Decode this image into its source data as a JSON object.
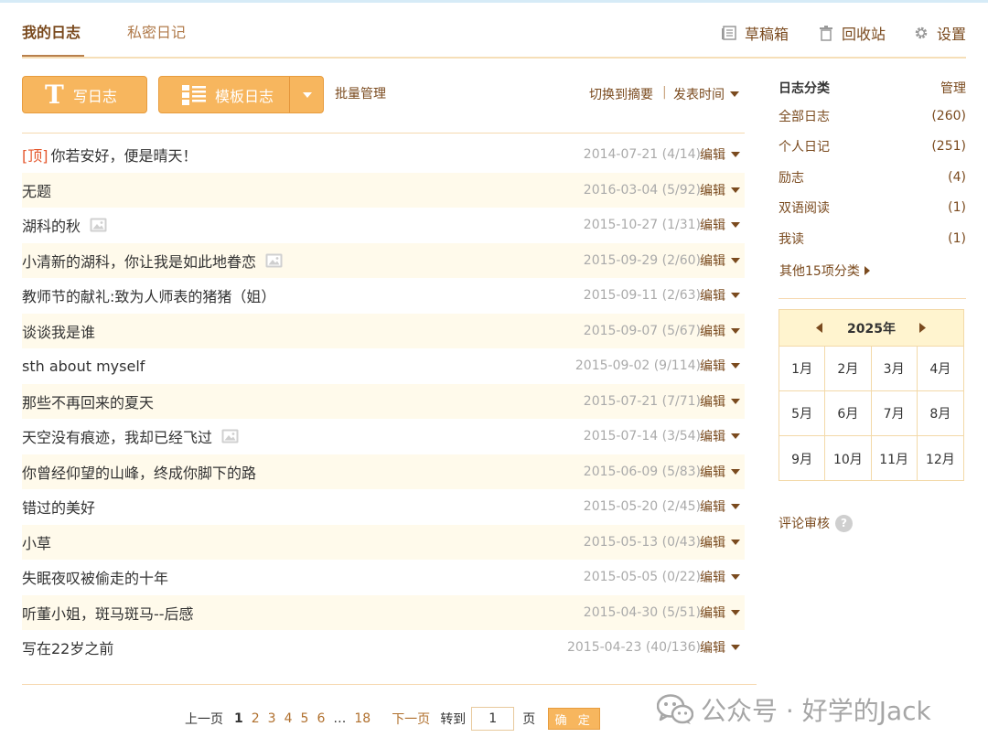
{
  "tabs": {
    "my_diary": "我的日志",
    "private_diary": "私密日记"
  },
  "tools": {
    "drafts": "草稿箱",
    "trash": "回收站",
    "settings": "设置"
  },
  "actions": {
    "write": "写日志",
    "template": "模板日志",
    "batch": "批量管理",
    "toggle_summary": "切换到摘要",
    "separator": "|",
    "sort": "发表时间"
  },
  "diary_list": [
    {
      "pin": "[顶]",
      "title": "你若安好，便是晴天！",
      "date": "2014-07-21",
      "stats": "(4/14)",
      "has_image": false
    },
    {
      "pin": "",
      "title": "无题",
      "date": "2016-03-04",
      "stats": "(5/92)",
      "has_image": false
    },
    {
      "pin": "",
      "title": "湖科的秋",
      "date": "2015-10-27",
      "stats": "(1/31)",
      "has_image": true
    },
    {
      "pin": "",
      "title": "小清新的湖科，你让我是如此地眷恋",
      "date": "2015-09-29",
      "stats": "(2/60)",
      "has_image": true
    },
    {
      "pin": "",
      "title": "教师节的献礼:致为人师表的猪猪（姐）",
      "date": "2015-09-11",
      "stats": "(2/63)",
      "has_image": false
    },
    {
      "pin": "",
      "title": "谈谈我是谁",
      "date": "2015-09-07",
      "stats": "(5/67)",
      "has_image": false
    },
    {
      "pin": "",
      "title": "sth about myself",
      "date": "2015-09-02",
      "stats": "(9/114)",
      "has_image": false
    },
    {
      "pin": "",
      "title": "那些不再回来的夏天",
      "date": "2015-07-21",
      "stats": "(7/71)",
      "has_image": false
    },
    {
      "pin": "",
      "title": "天空没有痕迹，我却已经飞过",
      "date": "2015-07-14",
      "stats": "(3/54)",
      "has_image": true
    },
    {
      "pin": "",
      "title": "你曾经仰望的山峰，终成你脚下的路",
      "date": "2015-06-09",
      "stats": "(5/83)",
      "has_image": false
    },
    {
      "pin": "",
      "title": "错过的美好",
      "date": "2015-05-20",
      "stats": "(2/45)",
      "has_image": false
    },
    {
      "pin": "",
      "title": "小草",
      "date": "2015-05-13",
      "stats": "(0/43)",
      "has_image": false
    },
    {
      "pin": "",
      "title": "失眠夜叹被偷走的十年",
      "date": "2015-05-05",
      "stats": "(0/22)",
      "has_image": false
    },
    {
      "pin": "",
      "title": "听董小姐，斑马斑马--后感",
      "date": "2015-04-30",
      "stats": "(5/51)",
      "has_image": false
    },
    {
      "pin": "",
      "title": "写在22岁之前",
      "date": "2015-04-23",
      "stats": "(40/136)",
      "has_image": false
    }
  ],
  "edit_label": "编辑",
  "pagination": {
    "prev": "上一页",
    "pages": [
      "1",
      "2",
      "3",
      "4",
      "5",
      "6"
    ],
    "current": "1",
    "ellipsis": "…",
    "last": "18",
    "next": "下一页",
    "goto": "转到",
    "input_value": "1",
    "page_unit": "页",
    "confirm": "确 定"
  },
  "sidebar": {
    "title": "日志分类",
    "manage": "管理",
    "categories": [
      {
        "name": "全部日志",
        "count": "(260)"
      },
      {
        "name": "个人日记",
        "count": "(251)"
      },
      {
        "name": "励志",
        "count": "(4)"
      },
      {
        "name": "双语阅读",
        "count": "(1)"
      },
      {
        "name": "我读",
        "count": "(1)"
      }
    ],
    "more": "其他15项分类",
    "calendar": {
      "year": "2025年",
      "months": [
        "1月",
        "2月",
        "3月",
        "4月",
        "5月",
        "6月",
        "7月",
        "8月",
        "9月",
        "10月",
        "11月",
        "12月"
      ]
    },
    "review": "评论审核",
    "help_glyph": "?"
  },
  "watermark": {
    "text": "公众号 · 好学的Jack"
  },
  "colors": {
    "accent": "#f7b65e",
    "link": "#7a4a1e",
    "pin": "#e5572d",
    "row_alt": "#fffaeb"
  }
}
